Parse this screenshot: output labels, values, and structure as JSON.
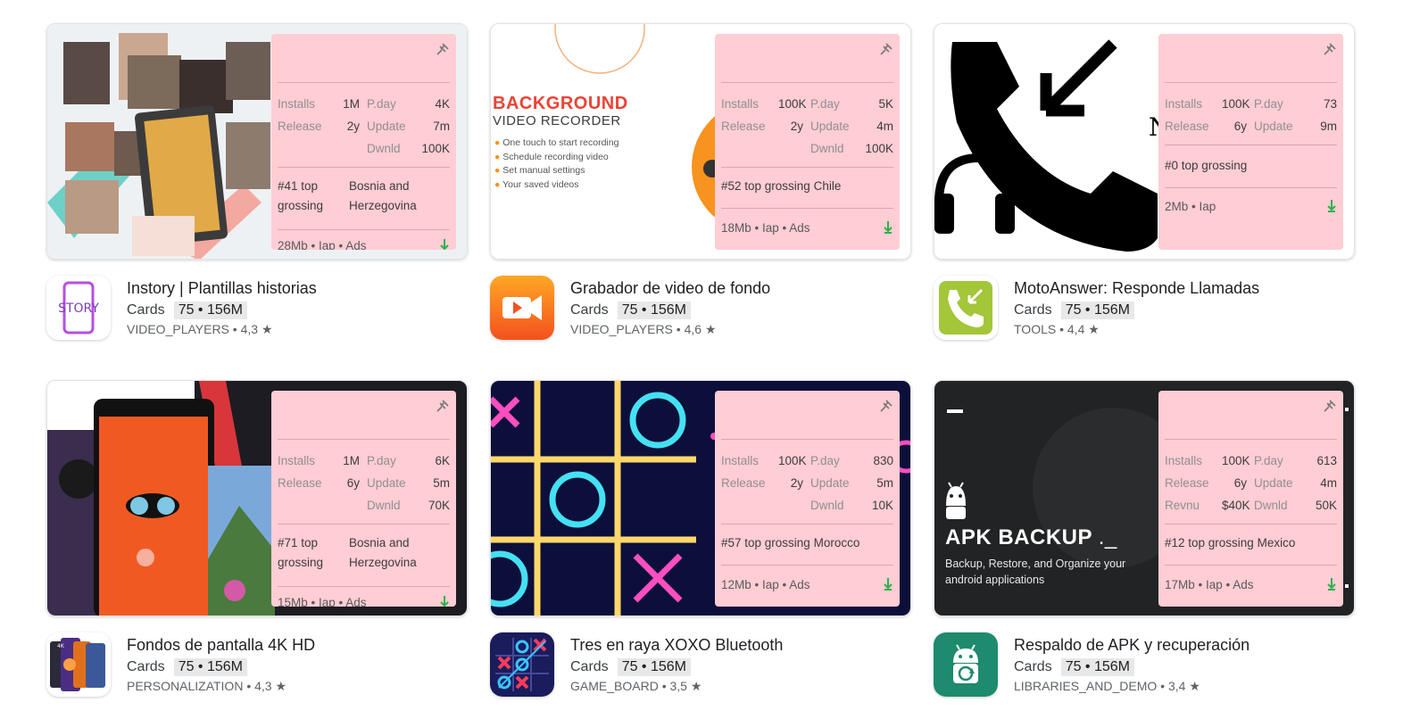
{
  "apps": [
    {
      "title": "Instory | Plantillas historias",
      "cards_label": "Cards",
      "badge": "75 • 156M",
      "category": "VIDEO_PLAYERS",
      "rating": "4,3 ★",
      "icon_name": "story-icon",
      "overlay": {
        "installs_label": "Installs",
        "installs": "1M",
        "pday_label": "P.day",
        "pday": "4K",
        "release_label": "Release",
        "release": "2y",
        "update_label": "Update",
        "update": "7m",
        "row3_label": "",
        "row3_value": "",
        "dwnld_label": "Dwnld",
        "dwnld": "100K",
        "rank": "#41 top grossing",
        "rank_country": "Bosnia and Herzegovina",
        "footer": "28Mb • Iap • Ads"
      }
    },
    {
      "title": "Grabador de video de fondo",
      "cards_label": "Cards",
      "badge": "75 • 156M",
      "category": "VIDEO_PLAYERS",
      "rating": "4,6 ★",
      "icon_name": "video-camera-icon",
      "overlay": {
        "installs_label": "Installs",
        "installs": "100K",
        "pday_label": "P.day",
        "pday": "5K",
        "release_label": "Release",
        "release": "2y",
        "update_label": "Update",
        "update": "4m",
        "row3_label": "",
        "row3_value": "",
        "dwnld_label": "Dwnld",
        "dwnld": "100K",
        "rank": "#52 top grossing Chile",
        "footer": "18Mb • Iap • Ads"
      },
      "banner_text": {
        "heading1": "BACKGROUND",
        "heading2": "VIDEO RECORDER",
        "bullets": [
          "One touch to start recording",
          "Schedule recording video",
          "Set manual settings",
          "Your saved videos"
        ]
      }
    },
    {
      "title": "MotoAnswer: Responde Llamadas",
      "cards_label": "Cards",
      "badge": "75 • 156M",
      "category": "TOOLS",
      "rating": "4,4 ★",
      "icon_name": "phone-answer-icon",
      "overlay": {
        "installs_label": "Installs",
        "installs": "100K",
        "pday_label": "P.day",
        "pday": "73",
        "release_label": "Release",
        "release": "6y",
        "update_label": "Update",
        "update": "9m",
        "rank": "#0 top grossing",
        "footer": "2Mb • Iap"
      }
    },
    {
      "title": "Fondos de pantalla 4K HD",
      "cards_label": "Cards",
      "badge": "75 • 156M",
      "category": "PERSONALIZATION",
      "rating": "4,3 ★",
      "icon_name": "wallpaper-icon",
      "overlay": {
        "installs_label": "Installs",
        "installs": "1M",
        "pday_label": "P.day",
        "pday": "6K",
        "release_label": "Release",
        "release": "6y",
        "update_label": "Update",
        "update": "5m",
        "row3_label": "",
        "row3_value": "",
        "dwnld_label": "Dwnld",
        "dwnld": "70K",
        "rank": "#71 top grossing",
        "rank_country": "Bosnia and Herzegovina",
        "footer": "15Mb • Iap • Ads"
      }
    },
    {
      "title": "Tres en raya XOXO Bluetooth",
      "cards_label": "Cards",
      "badge": "75 • 156M",
      "category": "GAME_BOARD",
      "rating": "3,5 ★",
      "icon_name": "tic-tac-toe-icon",
      "overlay": {
        "installs_label": "Installs",
        "installs": "100K",
        "pday_label": "P.day",
        "pday": "830",
        "release_label": "Release",
        "release": "2y",
        "update_label": "Update",
        "update": "5m",
        "row3_label": "",
        "row3_value": "",
        "dwnld_label": "Dwnld",
        "dwnld": "10K",
        "rank": "#57 top grossing Morocco",
        "footer": "12Mb • Iap • Ads"
      }
    },
    {
      "title": "Respaldo de APK y recuperación",
      "cards_label": "Cards",
      "badge": "75 • 156M",
      "category": "LIBRARIES_AND_DEMO",
      "rating": "3,4 ★",
      "icon_name": "android-backup-icon",
      "overlay": {
        "installs_label": "Installs",
        "installs": "100K",
        "pday_label": "P.day",
        "pday": "613",
        "release_label": "Release",
        "release": "6y",
        "update_label": "Update",
        "update": "4m",
        "row3_label": "Revnu",
        "row3_value": "$40K",
        "dwnld_label": "Dwnld",
        "dwnld": "50K",
        "rank": "#12 top grossing Mexico",
        "footer": "17Mb • Iap • Ads"
      },
      "banner_text": {
        "heading": "APK BACKUP",
        "sub": "Backup, Restore, and Organize your android applications"
      }
    }
  ],
  "colors": {
    "overlay_bg": "#ffcdd4",
    "download_green": "#2bb24c",
    "badge_bg": "#e8e8e8"
  }
}
